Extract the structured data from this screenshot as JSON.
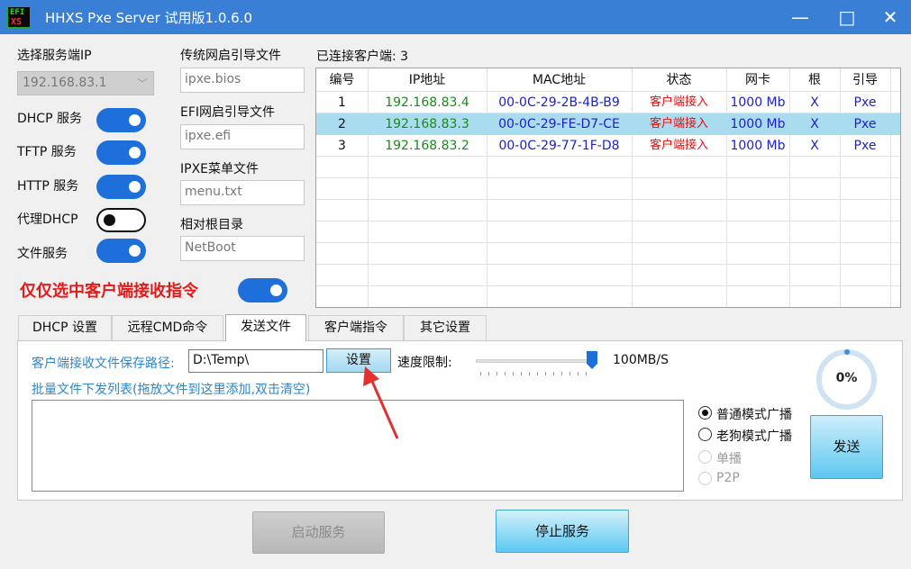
{
  "window": {
    "logo_top": "EFI",
    "logo_bottom": "XS",
    "title": "HHXS Pxe Server 试用版1.0.6.0",
    "minimize": "—",
    "maximize": "□",
    "close": "✕"
  },
  "left": {
    "server_ip_label": "选择服务端IP",
    "server_ip_value": "192.168.83.1",
    "services": [
      {
        "label": "DHCP 服务",
        "on": true
      },
      {
        "label": "TFTP 服务",
        "on": true
      },
      {
        "label": "HTTP 服务",
        "on": true
      },
      {
        "label": "代理DHCP",
        "on": false
      },
      {
        "label": "文件服务",
        "on": true
      }
    ],
    "only_selected_label": "仅仅选中客户端接收指令",
    "only_selected_on": true
  },
  "boot_files": {
    "legacy_label": "传统网启引导文件",
    "legacy_value": "ipxe.bios",
    "efi_label": "EFI网启引导文件",
    "efi_value": "ipxe.efi",
    "menu_label": "IPXE菜单文件",
    "menu_value": "menu.txt",
    "root_label": "相对根目录",
    "root_value": "NetBoot"
  },
  "clients": {
    "label": "已连接客户端: 3",
    "columns": [
      "编号",
      "IP地址",
      "MAC地址",
      "状态",
      "网卡",
      "根",
      "引导"
    ],
    "rows": [
      {
        "id": "1",
        "ip": "192.168.83.4",
        "mac": "00-0C-29-2B-4B-B9",
        "status": "客户端接入",
        "nic": "1000 Mb",
        "root": "X",
        "boot": "Pxe",
        "selected": false
      },
      {
        "id": "2",
        "ip": "192.168.83.3",
        "mac": "00-0C-29-FE-D7-CE",
        "status": "客户端接入",
        "nic": "1000 Mb",
        "root": "X",
        "boot": "Pxe",
        "selected": true
      },
      {
        "id": "3",
        "ip": "192.168.83.2",
        "mac": "00-0C-29-77-1F-D8",
        "status": "客户端接入",
        "nic": "1000 Mb",
        "root": "X",
        "boot": "Pxe",
        "selected": false
      }
    ]
  },
  "tabs": [
    "DHCP 设置",
    "远程CMD命令",
    "发送文件",
    "客户端指令",
    "其它设置"
  ],
  "active_tab": "发送文件",
  "send_file": {
    "save_path_label": "客户端接收文件保存路径:",
    "save_path_value": "D:\\Temp\\",
    "set_button": "设置",
    "speed_label": "速度限制:",
    "speed_value": "100MB/S",
    "speed_fraction": 1.0,
    "list_label": "批量文件下发列表(拖放文件到这里添加,双击清空)",
    "modes": [
      {
        "label": "普通模式广播",
        "checked": true,
        "enabled": true
      },
      {
        "label": "老狗模式广播",
        "checked": false,
        "enabled": true
      },
      {
        "label": "单播",
        "checked": false,
        "enabled": false
      },
      {
        "label": "P2P",
        "checked": false,
        "enabled": false
      }
    ],
    "progress_text": "0%",
    "send_button": "发送"
  },
  "bottom": {
    "start_button": "启动服务",
    "stop_button": "停止服务"
  },
  "colors": {
    "titlebar": "#3a7fd6",
    "toggle_on": "#1e6fd9",
    "selected_row": "#a9dcef",
    "warning_red": "#e31b1b"
  }
}
